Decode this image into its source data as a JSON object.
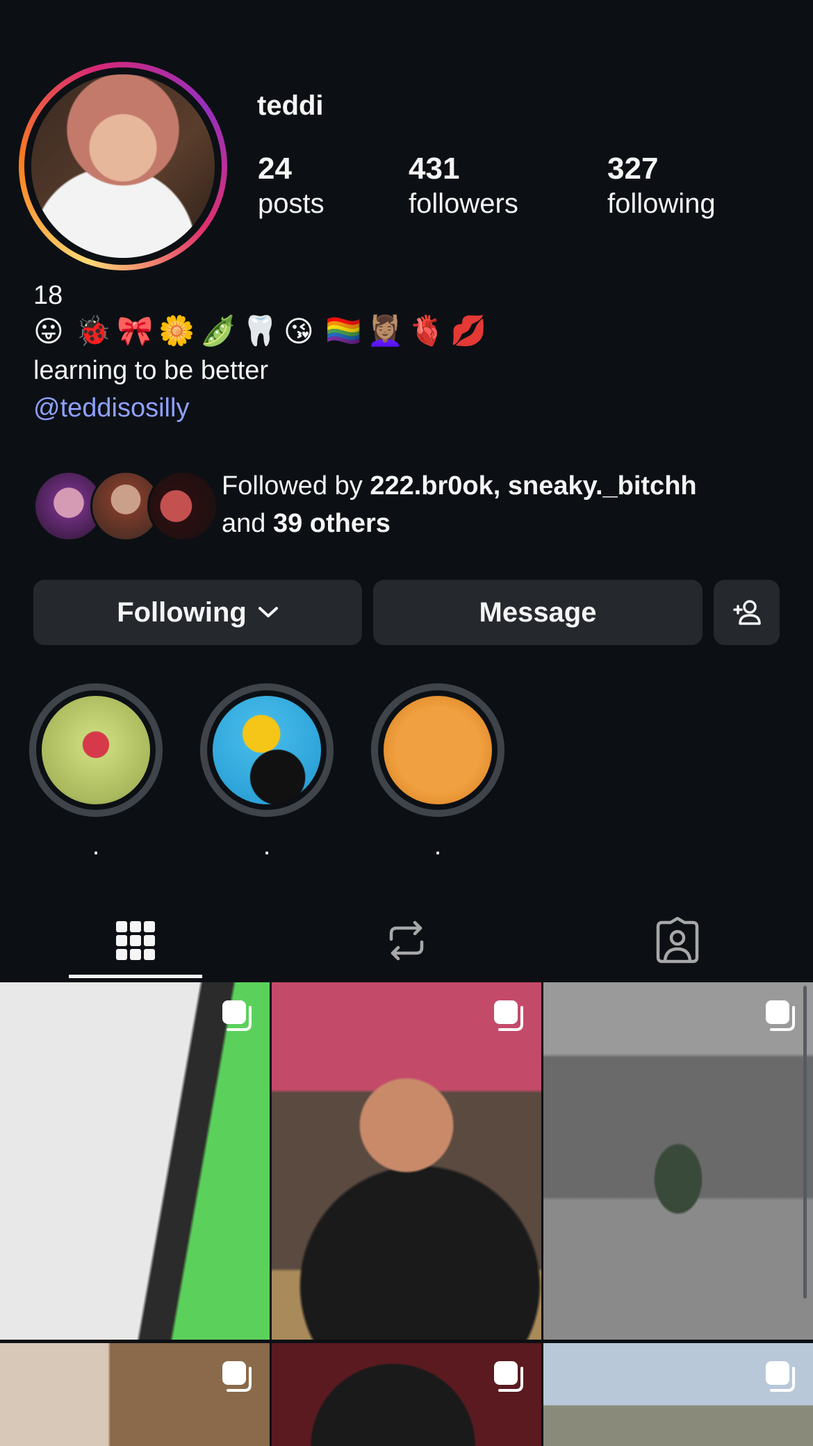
{
  "header": {
    "username": "teddi"
  },
  "profile": {
    "display_name": "teddi",
    "posts_count": "24",
    "posts_label": "posts",
    "followers_count": "431",
    "followers_label": "followers",
    "following_count": "327",
    "following_label": "following"
  },
  "bio": {
    "line1": "18",
    "emojis": [
      "😛",
      "🐞",
      "🎀",
      "🌼",
      "🫛",
      "🦷",
      "😘",
      "🏳️‍🌈",
      "💆🏽‍♀️",
      "🫀",
      "💋"
    ],
    "line3": "learning to be better",
    "link": "@teddisosilly"
  },
  "followed_by": {
    "prefix": "Followed by",
    "names": "222.br0ok, sneaky._bitchh",
    "and": "and",
    "others": "39 others"
  },
  "actions": {
    "following_label": "Following",
    "message_label": "Message"
  },
  "highlights": [
    {
      "label": "."
    },
    {
      "label": "."
    },
    {
      "label": "."
    }
  ],
  "tabs": [
    {
      "icon": "grid-icon"
    },
    {
      "icon": "reels-repost-icon"
    },
    {
      "icon": "tagged-icon"
    }
  ],
  "colors": {
    "background": "#0c1014",
    "button": "#25292e",
    "link": "#8ea1ff"
  }
}
